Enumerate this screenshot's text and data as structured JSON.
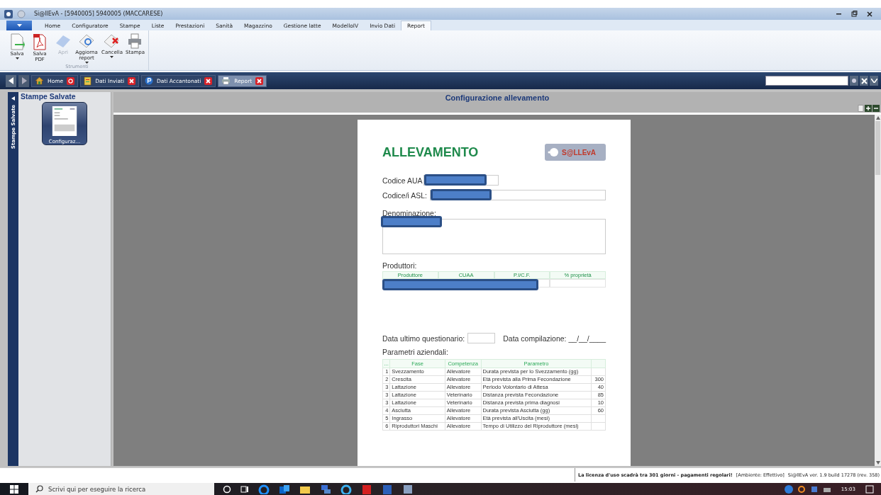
{
  "window": {
    "title": "Si@llEvA - [5940005] 5940005 (MACCARESE)"
  },
  "menu_tabs": [
    {
      "label": "Home",
      "selected": false
    },
    {
      "label": "Configuratore",
      "selected": false
    },
    {
      "label": "Stampe",
      "selected": false
    },
    {
      "label": "Liste",
      "selected": false
    },
    {
      "label": "Prestazioni",
      "selected": false
    },
    {
      "label": "Sanità",
      "selected": false
    },
    {
      "label": "Magazzino",
      "selected": false
    },
    {
      "label": "Gestione latte",
      "selected": false
    },
    {
      "label": "ModelloIV",
      "selected": false
    },
    {
      "label": "Invio Dati",
      "selected": false
    },
    {
      "label": "Report",
      "selected": true
    }
  ],
  "ribbon": {
    "group_label": "Strumenti",
    "buttons": [
      {
        "kind": "save",
        "label": "Salva",
        "disabled": false,
        "dropdown": true
      },
      {
        "kind": "pdf",
        "label": "Salva PDF",
        "disabled": false,
        "dropdown": false
      },
      {
        "kind": "open",
        "label": "Apri",
        "disabled": true,
        "dropdown": false
      },
      {
        "kind": "refresh",
        "label": "Aggiorna report",
        "disabled": false,
        "dropdown": true
      },
      {
        "kind": "delete",
        "label": "Cancella",
        "disabled": false,
        "dropdown": true
      },
      {
        "kind": "print",
        "label": "Stampa",
        "disabled": false,
        "dropdown": false
      }
    ]
  },
  "doc_tabs": [
    {
      "label": "Home",
      "kind": "home",
      "selected": false
    },
    {
      "label": "Dati Inviati",
      "kind": "sent",
      "selected": false
    },
    {
      "label": "Dati Accantonati",
      "kind": "parked",
      "selected": false
    },
    {
      "label": "Report",
      "kind": "report",
      "selected": true
    }
  ],
  "side_panel": {
    "vertical_label": "Stampe Salvate",
    "title": "Stampe Salvate",
    "items": [
      {
        "label": "Configuraz..."
      }
    ]
  },
  "viewer": {
    "title": "Configurazione allevamento"
  },
  "report": {
    "title": "ALLEVAMENTO",
    "logo_text": "S@LLEvA",
    "fields": {
      "aua": "Codice AUA",
      "asl": "Codice/i ASL:",
      "name": "Denominazione:"
    },
    "producers": {
      "label": "Produttori:",
      "columns": [
        "Produttore",
        "CUAA",
        "P.I/C.F.",
        "% proprietà"
      ]
    },
    "last_survey": "Data ultimo questionario:",
    "compiled": "Data compilazione:  __/__/____",
    "parameters": {
      "label": "Parametri aziendali:",
      "columns": [
        "...",
        "Fase",
        "Competenza",
        "Parametro"
      ],
      "rows": [
        {
          "n": "1",
          "fase": "Svezzamento",
          "competenza": "Allevatore",
          "parametro": "Durata prevista per lo Svezzamento (gg)",
          "valore": ""
        },
        {
          "n": "2",
          "fase": "Crescita",
          "competenza": "Allevatore",
          "parametro": "Età prevista alla Prima Fecondazione",
          "valore": "300"
        },
        {
          "n": "3",
          "fase": "Lattazione",
          "competenza": "Allevatore",
          "parametro": "Periodo Volontario di Attesa",
          "valore": "40"
        },
        {
          "n": "3",
          "fase": "Lattazione",
          "competenza": "Veterinario",
          "parametro": "Distanza prevista Fecondazione",
          "valore": "85"
        },
        {
          "n": "3",
          "fase": "Lattazione",
          "competenza": "Veterinario",
          "parametro": "Distanza prevista prima diagnosi",
          "valore": "10"
        },
        {
          "n": "4",
          "fase": "Asciutta",
          "competenza": "Allevatore",
          "parametro": "Durata prevista Asciutta (gg)",
          "valore": "60"
        },
        {
          "n": "5",
          "fase": "Ingrasso",
          "competenza": "Allevatore",
          "parametro": "Età prevista all'Uscita (mesi)",
          "valore": ""
        },
        {
          "n": "6",
          "fase": "Riproduttori Maschi",
          "competenza": "Allevatore",
          "parametro": "Tempo di Utilizzo del Riproduttore (mesi)",
          "valore": ""
        }
      ]
    }
  },
  "status_bar": {
    "message": "La licenza d'uso scadrà tra 301 giorni - pagamenti regolari!",
    "environment": "[Ambiente: Effettivo]",
    "version": "Si@llEvA ver. 1.9   build 17278 (rev. 358)"
  },
  "taskbar": {
    "search_placeholder": "Scrivi qui per eseguire la ricerca",
    "time": "15:03"
  }
}
